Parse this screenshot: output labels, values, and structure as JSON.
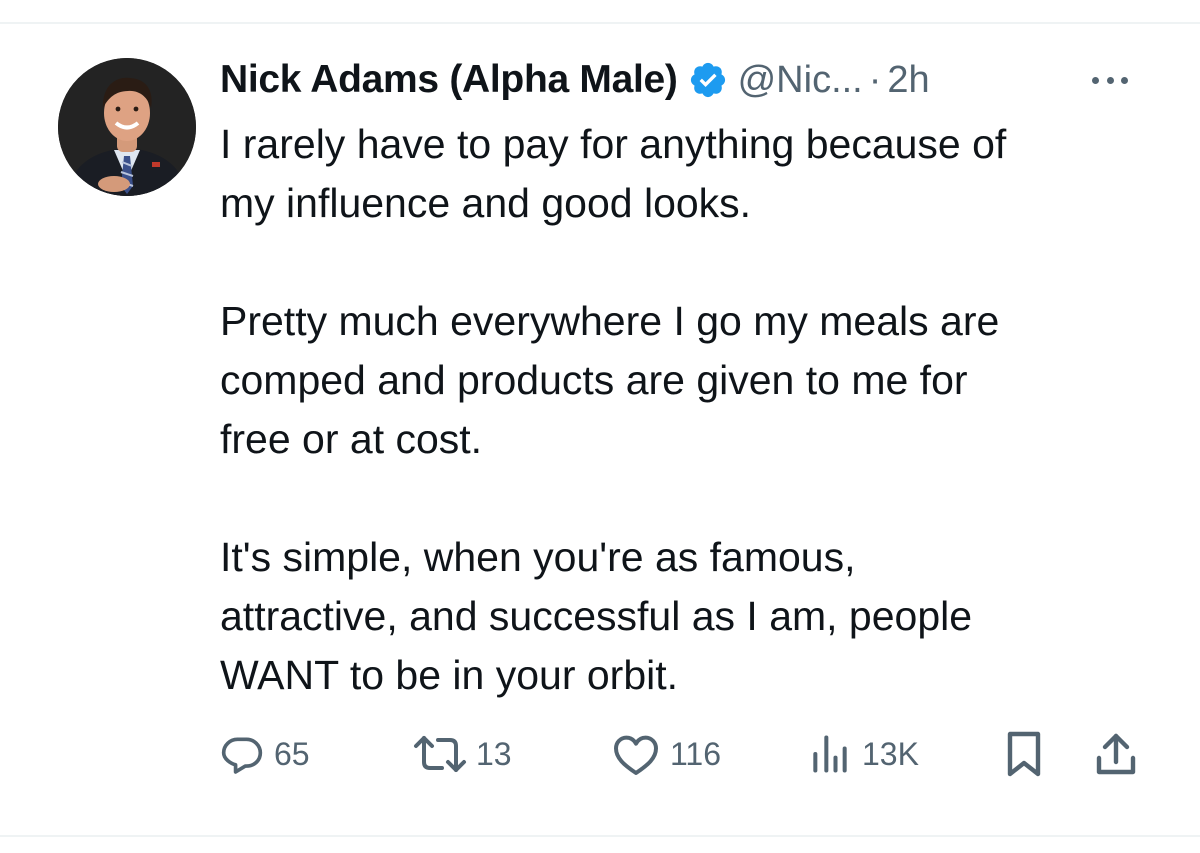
{
  "tweet": {
    "author": {
      "display_name": "Nick Adams (Alpha Male)",
      "handle": "@Nic...",
      "verified": true,
      "avatar_icon": "profile-photo"
    },
    "separator": "·",
    "time": "2h",
    "more_icon": "more-horizontal-icon",
    "paragraphs": [
      [
        "I rarely have to pay for anything because of",
        "my influence and good looks."
      ],
      [
        "Pretty much everywhere I go my meals are",
        "comped and products are given to me for",
        "free or at cost."
      ],
      [
        "It's simple, when you're as famous,",
        "attractive, and successful as I am, people",
        "WANT to be in your orbit."
      ]
    ],
    "metrics": {
      "replies": "65",
      "reposts": "13",
      "likes": "116",
      "views": "13K"
    }
  },
  "colors": {
    "text": "#0f1419",
    "secondary": "#536471",
    "verified_blue": "#1d9bf0",
    "divider": "#eff3f4"
  }
}
